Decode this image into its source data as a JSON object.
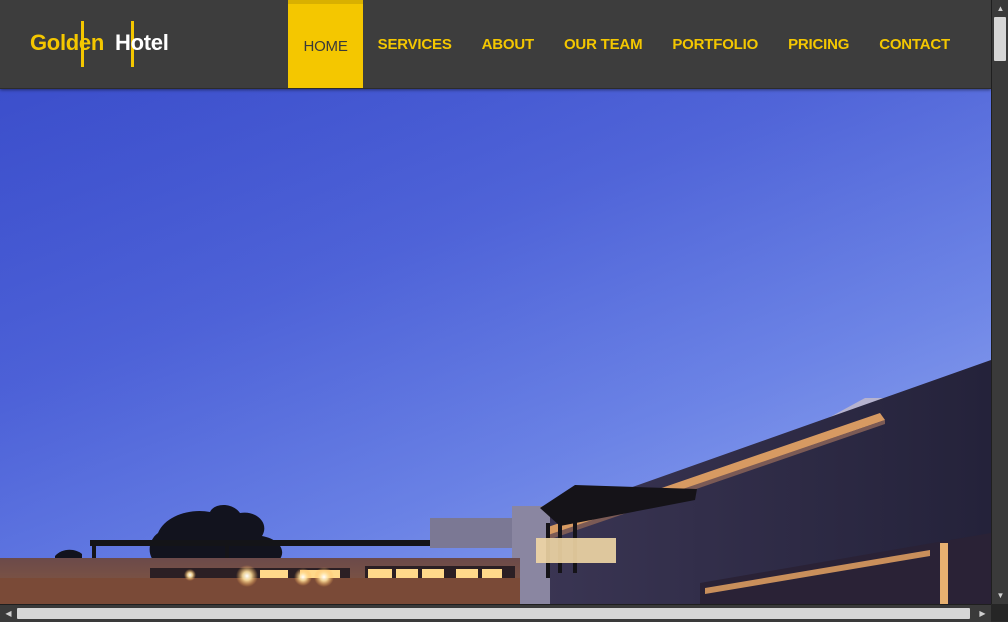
{
  "brand": {
    "word1": "Golden",
    "word2": "Hotel",
    "accent_color": "#f4c700",
    "nav_bg_color": "#3d3d3d"
  },
  "nav": {
    "items": [
      {
        "label": "HOME",
        "active": true
      },
      {
        "label": "SERVICES",
        "active": false
      },
      {
        "label": "ABOUT",
        "active": false
      },
      {
        "label": "OUR TEAM",
        "active": false
      },
      {
        "label": "PORTFOLIO",
        "active": false
      },
      {
        "label": "PRICING",
        "active": false
      },
      {
        "label": "CONTACT",
        "active": false
      }
    ]
  },
  "hero": {
    "image_subject": "hotel building at dusk",
    "sky_color": "#4a5fd8"
  },
  "scrollbars": {
    "vertical": {
      "up_icon": "triangle-up-icon",
      "down_icon": "triangle-down-icon"
    },
    "horizontal": {
      "left_icon": "triangle-left-icon",
      "right_icon": "triangle-right-icon"
    }
  }
}
